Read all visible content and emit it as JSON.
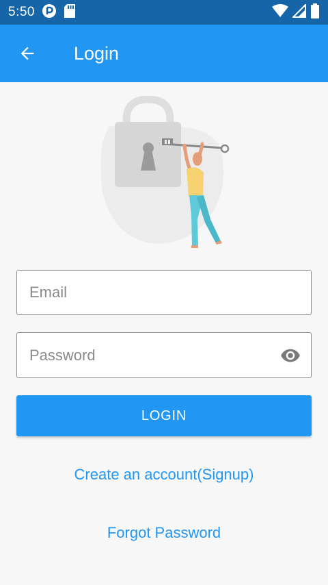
{
  "status_bar": {
    "time": "5:50",
    "icons": [
      "pocket-casts-icon",
      "sd-card-icon",
      "wifi-icon",
      "signal-icon",
      "battery-icon"
    ]
  },
  "app_bar": {
    "title": "Login",
    "back_icon": "arrow-left-icon",
    "color": "#2196f3"
  },
  "illustration": "lock-and-key-person-icon",
  "form": {
    "email_placeholder": "Email",
    "email_value": "",
    "password_placeholder": "Password",
    "password_value": "",
    "visibility_icon": "eye-icon",
    "login_label": "LOGIN"
  },
  "links": {
    "signup": "Create an account(Signup)",
    "forgot": "Forgot Password"
  },
  "colors": {
    "primary": "#2196f3",
    "status_bar": "#1565a8",
    "background": "#f7f7f7"
  }
}
